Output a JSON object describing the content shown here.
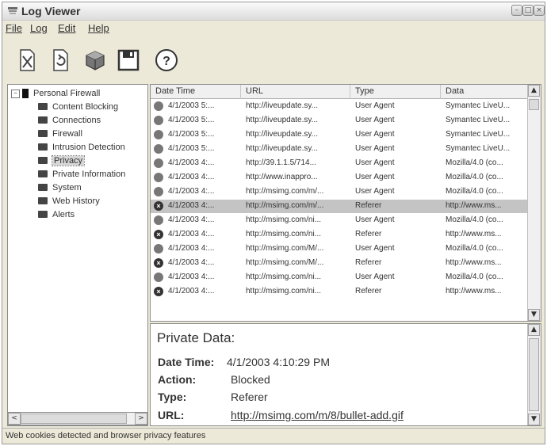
{
  "window": {
    "title": "Log Viewer"
  },
  "menu": [
    "File",
    "Log",
    "Edit",
    "Help"
  ],
  "toolbar": [
    {
      "name": "clear-log-icon"
    },
    {
      "name": "refresh-icon"
    },
    {
      "name": "gear-icon"
    },
    {
      "name": "save-icon"
    },
    {
      "name": "help-icon"
    }
  ],
  "tree": {
    "root": "Personal Firewall",
    "items": [
      "Content Blocking",
      "Connections",
      "Firewall",
      "Intrusion Detection",
      "Privacy",
      "Private Information",
      "System",
      "Web History",
      "Alerts"
    ],
    "selected": "Privacy"
  },
  "grid": {
    "columns": [
      "Date Time",
      "URL",
      "Type",
      "Data"
    ],
    "rows": [
      {
        "status": "info",
        "date": "4/1/2003 5:...",
        "url": "http://liveupdate.sy...",
        "type": "User Agent",
        "data": "Symantec LiveU..."
      },
      {
        "status": "info",
        "date": "4/1/2003 5:...",
        "url": "http://liveupdate.sy...",
        "type": "User Agent",
        "data": "Symantec LiveU..."
      },
      {
        "status": "info",
        "date": "4/1/2003 5:...",
        "url": "http://liveupdate.sy...",
        "type": "User Agent",
        "data": "Symantec LiveU..."
      },
      {
        "status": "info",
        "date": "4/1/2003 5:...",
        "url": "http://liveupdate.sy...",
        "type": "User Agent",
        "data": "Symantec LiveU..."
      },
      {
        "status": "info",
        "date": "4/1/2003 4:...",
        "url": "http://39.1.1.5/714...",
        "type": "User Agent",
        "data": "Mozilla/4.0 (co..."
      },
      {
        "status": "info",
        "date": "4/1/2003 4:...",
        "url": "http://www.inappro...",
        "type": "User Agent",
        "data": "Mozilla/4.0 (co..."
      },
      {
        "status": "info",
        "date": "4/1/2003 4:...",
        "url": "http://msimg.com/m/...",
        "type": "User Agent",
        "data": "Mozilla/4.0 (co..."
      },
      {
        "status": "blocked",
        "date": "4/1/2003 4:...",
        "url": "http://msimg.com/m/...",
        "type": "Referer",
        "data": "http://www.ms...",
        "selected": true
      },
      {
        "status": "info",
        "date": "4/1/2003 4:...",
        "url": "http://msimg.com/ni...",
        "type": "User Agent",
        "data": "Mozilla/4.0 (co..."
      },
      {
        "status": "blocked",
        "date": "4/1/2003 4:...",
        "url": "http://msimg.com/ni...",
        "type": "Referer",
        "data": "http://www.ms..."
      },
      {
        "status": "info",
        "date": "4/1/2003 4:...",
        "url": "http://msimg.com/M/...",
        "type": "User Agent",
        "data": "Mozilla/4.0 (co..."
      },
      {
        "status": "blocked",
        "date": "4/1/2003 4:...",
        "url": "http://msimg.com/M/...",
        "type": "Referer",
        "data": "http://www.ms..."
      },
      {
        "status": "info",
        "date": "4/1/2003 4:...",
        "url": "http://msimg.com/ni...",
        "type": "User Agent",
        "data": "Mozilla/4.0 (co..."
      },
      {
        "status": "blocked",
        "date": "4/1/2003 4:...",
        "url": "http://msimg.com/ni...",
        "type": "Referer",
        "data": "http://www.ms..."
      }
    ]
  },
  "detail": {
    "title": "Private Data:",
    "datetime_label": "Date Time:",
    "datetime_value": "4/1/2003 4:10:29 PM",
    "action_label": "Action:",
    "action_value": "Blocked",
    "type_label": "Type:",
    "type_value": "Referer",
    "url_label": "URL:",
    "url_value": "http://msimg.com/m/8/bullet-add.gif"
  },
  "status": "Web cookies detected and browser privacy features"
}
